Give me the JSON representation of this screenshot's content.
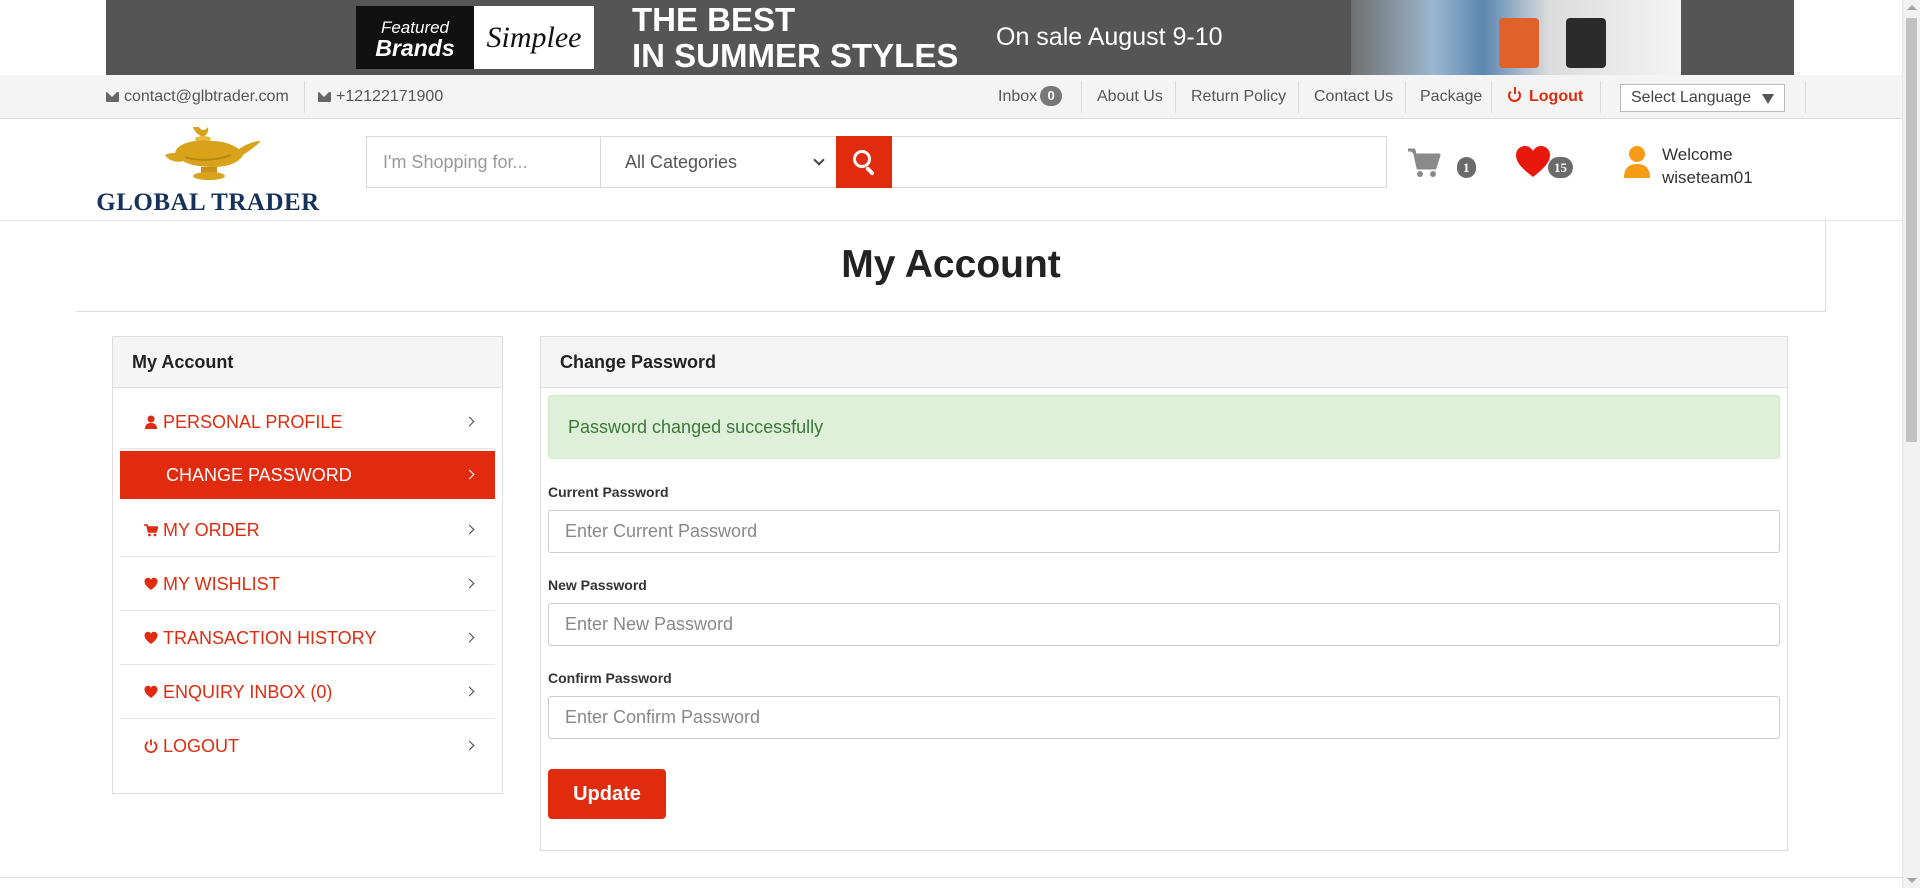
{
  "banner": {
    "featured_line1": "Featured",
    "featured_line2": "Brands",
    "brand": "Simplee",
    "headline_line1": "THE BEST",
    "headline_line2": "IN SUMMER STYLES",
    "sale_text": "On sale August 9-10"
  },
  "topbar": {
    "email": "contact@glbtrader.com",
    "phone": "+12122171900",
    "inbox_label": "Inbox",
    "inbox_count": "0",
    "about": "About Us",
    "return_policy": "Return Policy",
    "contact": "Contact Us",
    "package": "Package",
    "logout": "Logout",
    "language": "Select Language"
  },
  "header": {
    "logo_text": "GLOBAL TRADER",
    "search_placeholder": "I'm Shopping for...",
    "category": "All Categories",
    "cart_count": "1",
    "wishlist_count": "15",
    "welcome_line1": "Welcome",
    "welcome_line2": "wiseteam01"
  },
  "page_title": "My Account",
  "sidebar": {
    "title": "My Account",
    "items": [
      {
        "label": "PERSONAL PROFILE",
        "icon": "user-icon"
      },
      {
        "label": "CHANGE PASSWORD",
        "icon": "none"
      },
      {
        "label": "MY ORDER",
        "icon": "cart-icon"
      },
      {
        "label": "MY WISHLIST",
        "icon": "heart-icon"
      },
      {
        "label": "TRANSACTION HISTORY",
        "icon": "heart-icon"
      },
      {
        "label": "ENQUIRY INBOX (0)",
        "icon": "heart-icon"
      },
      {
        "label": "LOGOUT",
        "icon": "power-icon"
      }
    ]
  },
  "panel": {
    "title": "Change Password",
    "alert": "Password changed successfully",
    "current_label": "Current Password",
    "current_placeholder": "Enter Current Password",
    "new_label": "New Password",
    "new_placeholder": "Enter New Password",
    "confirm_label": "Confirm Password",
    "confirm_placeholder": "Enter Confirm Password",
    "update_label": "Update"
  },
  "colors": {
    "accent": "#e02b0f",
    "alert_bg": "#dff0d8",
    "alert_text": "#3c763d",
    "logo_blue": "#16325c",
    "lamp_gold": "#d9a21b",
    "user_orange": "#f59b16"
  }
}
